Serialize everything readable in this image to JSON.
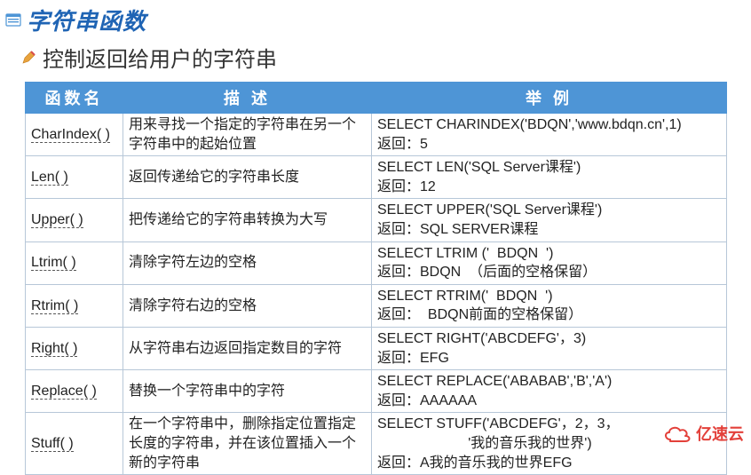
{
  "title": "字符串函数",
  "subtitle": "控制返回给用户的字符串",
  "headers": {
    "name": "函数名",
    "desc": "描  述",
    "example": "举  例"
  },
  "rows": [
    {
      "fn": "CharIndex( )",
      "desc": "用来寻找一个指定的字符串在另一个字符串中的起始位置",
      "ex1": "SELECT CHARINDEX('BDQN','www.bdqn.cn',1)",
      "ex2": "返回：5"
    },
    {
      "fn": "Len( )",
      "desc": "返回传递给它的字符串长度",
      "ex1": "SELECT LEN('SQL Server课程')",
      "ex2": "返回：12"
    },
    {
      "fn": "Upper( )",
      "desc": "把传递给它的字符串转换为大写",
      "ex1": "SELECT UPPER('SQL Server课程')",
      "ex2": "返回：SQL SERVER课程"
    },
    {
      "fn": "Ltrim( )",
      "desc": "清除字符左边的空格",
      "ex1": "SELECT LTRIM ('  BDQN  ')",
      "ex2": "返回：BDQN  （后面的空格保留）"
    },
    {
      "fn": "Rtrim( )",
      "desc": "清除字符右边的空格",
      "ex1": "SELECT RTRIM('  BDQN  ')",
      "ex2": "返回：  BDQN前面的空格保留）"
    },
    {
      "fn": "Right( )",
      "desc": "从字符串右边返回指定数目的字符",
      "ex1": "SELECT RIGHT('ABCDEFG'，3)",
      "ex2": "返回：EFG"
    },
    {
      "fn": "Replace( )",
      "desc": "替换一个字符串中的字符",
      "ex1": "SELECT REPLACE('ABABAB','B','A')",
      "ex2": "返回：AAAAAA"
    },
    {
      "fn": "Stuff( )",
      "desc": "在一个字符串中，删除指定位置指定长度的字符串，并在该位置插入一个新的字符串",
      "ex1": "SELECT STUFF('ABCDEFG'，2，3，",
      "ex2": "                       '我的音乐我的世界')",
      "ex3": "返回：A我的音乐我的世界EFG"
    }
  ],
  "logo_text": "亿速云",
  "chart_data": {
    "type": "table",
    "title": "字符串函数",
    "columns": [
      "函数名",
      "描述",
      "举例"
    ],
    "rows": [
      [
        "CharIndex( )",
        "用来寻找一个指定的字符串在另一个字符串中的起始位置",
        "SELECT CHARINDEX('BDQN','www.bdqn.cn',1) 返回：5"
      ],
      [
        "Len( )",
        "返回传递给它的字符串长度",
        "SELECT LEN('SQL Server课程') 返回：12"
      ],
      [
        "Upper( )",
        "把传递给它的字符串转换为大写",
        "SELECT UPPER('SQL Server课程') 返回：SQL SERVER课程"
      ],
      [
        "Ltrim( )",
        "清除字符左边的空格",
        "SELECT LTRIM ('  BDQN  ') 返回：BDQN  （后面的空格保留）"
      ],
      [
        "Rtrim( )",
        "清除字符右边的空格",
        "SELECT RTRIM('  BDQN  ') 返回：  BDQN前面的空格保留）"
      ],
      [
        "Right( )",
        "从字符串右边返回指定数目的字符",
        "SELECT RIGHT('ABCDEFG'，3) 返回：EFG"
      ],
      [
        "Replace( )",
        "替换一个字符串中的字符",
        "SELECT REPLACE('ABABAB','B','A') 返回：AAAAAA"
      ],
      [
        "Stuff( )",
        "在一个字符串中，删除指定位置指定长度的字符串，并在该位置插入一个新的字符串",
        "SELECT STUFF('ABCDEFG'，2，3，'我的音乐我的世界') 返回：A我的音乐我的世界EFG"
      ]
    ]
  }
}
